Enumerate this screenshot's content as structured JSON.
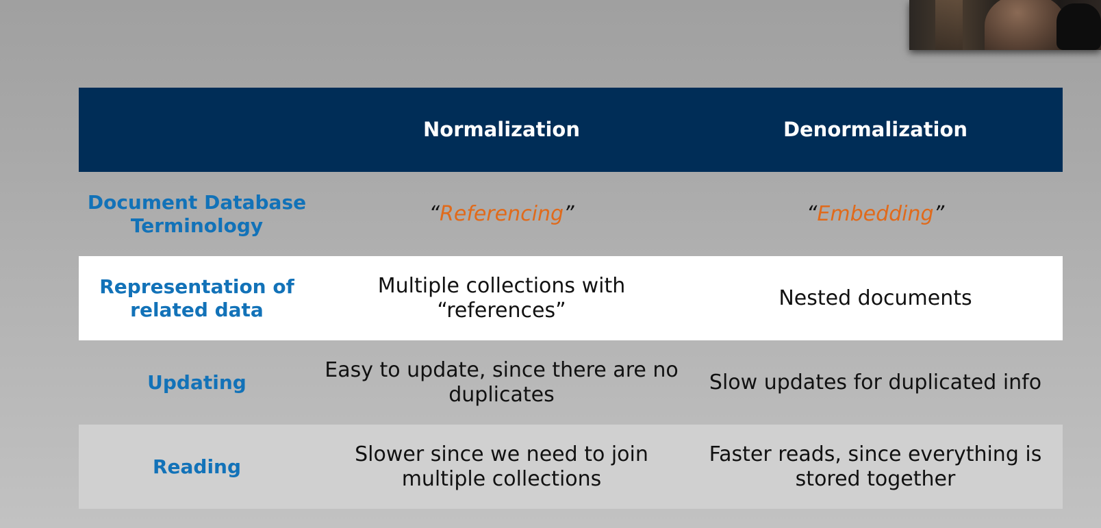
{
  "table": {
    "header": {
      "col_normalization": "Normalization",
      "col_denormalization": "Denormalization"
    },
    "rows": [
      {
        "label": "Document Database Terminology",
        "normalization": {
          "open_quote": "“",
          "term": "Referencing",
          "close_quote": "”"
        },
        "denormalization": {
          "open_quote": "“",
          "term": "Embedding",
          "close_quote": "”"
        }
      },
      {
        "label": "Representation of related data",
        "normalization": "Multiple collections with “references”",
        "denormalization": "Nested documents"
      },
      {
        "label": "Updating",
        "normalization": "Easy to update, since there are no duplicates",
        "denormalization": "Slow updates for duplicated info"
      },
      {
        "label": "Reading",
        "normalization": "Slower since we need to join multiple collections",
        "denormalization": "Faster reads, since everything is stored together"
      }
    ]
  },
  "colors": {
    "header_bg": "#002d57",
    "label_text": "#1272b8",
    "term_accent": "#e06a1b"
  }
}
